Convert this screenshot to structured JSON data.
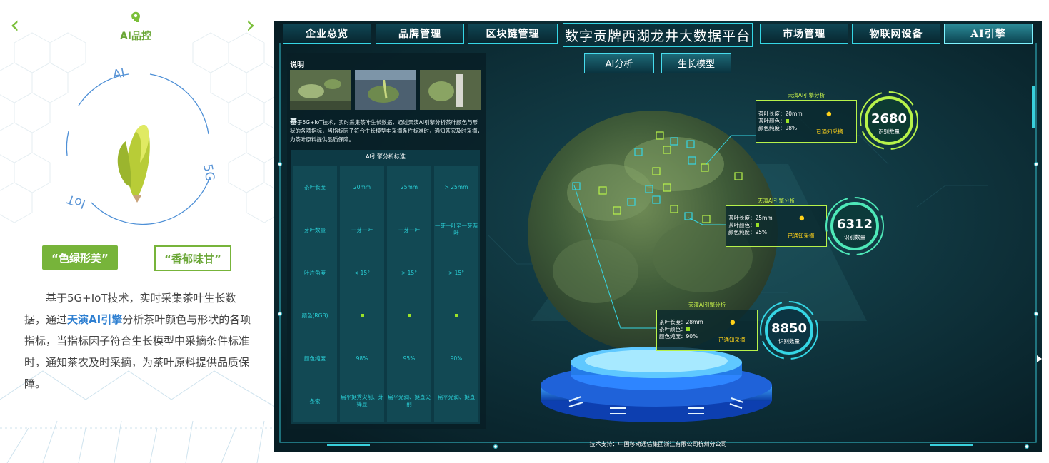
{
  "mobile": {
    "title": "AI品控",
    "ring_labels": {
      "top": "AI",
      "right": "5G",
      "left": "IoT"
    },
    "btn_primary": "“色绿形美”",
    "btn_secondary": "“香郁味甘”",
    "desc_part1": "基于5G+IoT技术，实时采集茶叶生长数据，通过",
    "desc_highlight": "天演AI引擎",
    "desc_part2": "分析茶叶颜色与形状的各项指标，当指标因子符合生长模型中采摘条件标准时，通知茶农及时采摘，为茶叶原料提供品质保障。",
    "accent": "#77b43a"
  },
  "dashboard": {
    "title": "数字贡牌西湖龙井大数据平台",
    "nav_left": [
      "企业总览",
      "品牌管理",
      "区块链管理"
    ],
    "nav_right": [
      "市场管理",
      "物联网设备",
      "AI引擎"
    ],
    "subtabs": [
      "AI分析",
      "生长模型"
    ],
    "info": {
      "title": "说明",
      "text_lead": "基",
      "text": "于5G+IoT技术，实时采集茶叶生长数据，通过天演AI引擎分析茶叶颜色与形状的各项指标，当指标因子符合生长模型中采摘条件标准时，通知茶农及时采摘，为茶叶原料提供品质保障。",
      "table_title": "AI引擎分析标准",
      "row_headers": [
        "茶叶长度",
        "芽叶数量",
        "叶片角度",
        "颜色(RGB)",
        "颜色纯度",
        "条索"
      ],
      "columns": [
        [
          "20mm",
          "一芽一叶",
          "< 15°",
          "",
          "98%",
          "扁平挺秀尖削、芽锋显"
        ],
        [
          "25mm",
          "一芽一叶",
          "> 15°",
          "",
          "95%",
          "扁平光润、挺直尖削"
        ],
        [
          "> 25mm",
          "一芽一叶至一芽两叶",
          "> 15°",
          "",
          "90%",
          "扁平光润、挺直"
        ]
      ]
    },
    "callouts": [
      {
        "title": "天演AI引擎分析",
        "length": "茶叶长度：20mm",
        "color": "茶叶颜色：",
        "purity": "颜色纯度：98%",
        "status": "已通知采摘",
        "count": "2680",
        "count_label": "识别数量"
      },
      {
        "title": "天演AI引擎分析",
        "length": "茶叶长度：25mm",
        "color": "茶叶颜色：",
        "purity": "颜色纯度：95%",
        "status": "已通知采摘",
        "count": "6312",
        "count_label": "识别数量"
      },
      {
        "title": "天演AI引擎分析",
        "length": "茶叶长度：28mm",
        "color": "茶叶颜色：",
        "purity": "颜色纯度：90%",
        "status": "已通知采摘",
        "count": "8850",
        "count_label": "识别数量"
      }
    ],
    "footer": "技术支持：中国移动通信集团浙江有限公司杭州分公司",
    "accent": "#35d6e5",
    "highlight": "#b7f24a"
  }
}
